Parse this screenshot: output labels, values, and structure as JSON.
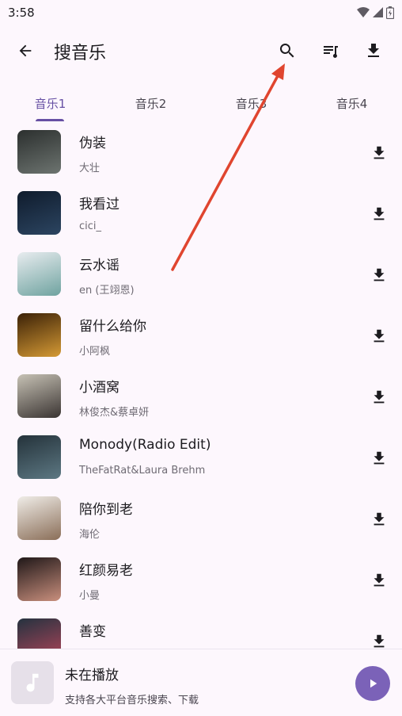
{
  "status": {
    "time": "3:58"
  },
  "header": {
    "title": "搜音乐"
  },
  "tabs": [
    {
      "label": "音乐1",
      "active": true
    },
    {
      "label": "音乐2",
      "active": false
    },
    {
      "label": "音乐3",
      "active": false
    },
    {
      "label": "音乐4",
      "active": false
    }
  ],
  "songs": [
    {
      "title": "伪装",
      "artist": "大壮",
      "cover_colors": [
        "#2b2f2e",
        "#6d7470"
      ]
    },
    {
      "title": "我看过",
      "artist": "cici_",
      "cover_colors": [
        "#0f1b2c",
        "#2c4561"
      ]
    },
    {
      "title": "云水谣",
      "artist": "en (王翊恩)",
      "cover_colors": [
        "#e8ecef",
        "#6fa3a0"
      ]
    },
    {
      "title": "留什么给你",
      "artist": "小阿枫",
      "cover_colors": [
        "#3b2107",
        "#d59a35"
      ]
    },
    {
      "title": "小酒窝",
      "artist": "林俊杰&蔡卓妍",
      "cover_colors": [
        "#c7c2b5",
        "#3a3432"
      ]
    },
    {
      "title": "Monody(Radio Edit)",
      "artist": "TheFatRat&Laura Brehm",
      "cover_colors": [
        "#24323a",
        "#5d7883"
      ]
    },
    {
      "title": "陪你到老",
      "artist": "海伦",
      "cover_colors": [
        "#f0ede8",
        "#8a6e58"
      ]
    },
    {
      "title": "红颜易老",
      "artist": "小曼",
      "cover_colors": [
        "#1f1718",
        "#c98f7d"
      ]
    },
    {
      "title": "善变",
      "artist": "",
      "cover_colors": [
        "#24323f",
        "#b3455a"
      ]
    }
  ],
  "player": {
    "title": "未在播放",
    "subtitle": "支持各大平台音乐搜索、下载"
  },
  "colors": {
    "accent": "#6750a4",
    "annotation": "#e0452f"
  }
}
